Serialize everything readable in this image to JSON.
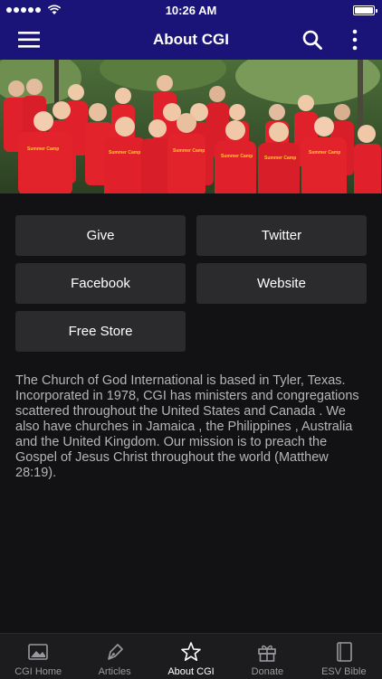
{
  "status_bar": {
    "time": "10:26 AM"
  },
  "header": {
    "title": "About CGI"
  },
  "icons": {
    "menu": "menu-icon",
    "search": "search-icon",
    "more": "more-vertical-icon",
    "tab_home": "image-icon",
    "tab_articles": "pen-icon",
    "tab_about": "star-icon",
    "tab_donate": "gift-icon",
    "tab_bible": "book-icon"
  },
  "hero": {
    "banner_text": "Summer Camp"
  },
  "buttons": {
    "give": "Give",
    "twitter": "Twitter",
    "facebook": "Facebook",
    "website": "Website",
    "free_store": "Free Store"
  },
  "about_text": "The Church of God International is based in Tyler, Texas. Incorporated in 1978, CGI has ministers and congregations scattered throughout the United States and Canada . We also have churches in Jamaica , the Philippines , Australia and the United Kingdom. Our mission is to preach the Gospel of Jesus Christ throughout the world (Matthew 28:19).",
  "tabs": [
    {
      "label": "CGI Home",
      "active": false
    },
    {
      "label": "Articles",
      "active": false
    },
    {
      "label": "About CGI",
      "active": true
    },
    {
      "label": "Donate",
      "active": false
    },
    {
      "label": "ESV Bible",
      "active": false
    }
  ],
  "colors": {
    "nav_bg": "#1a1478",
    "page_bg": "#121214",
    "button_bg": "#2b2b2d",
    "shirt_red": "#e0202a"
  }
}
